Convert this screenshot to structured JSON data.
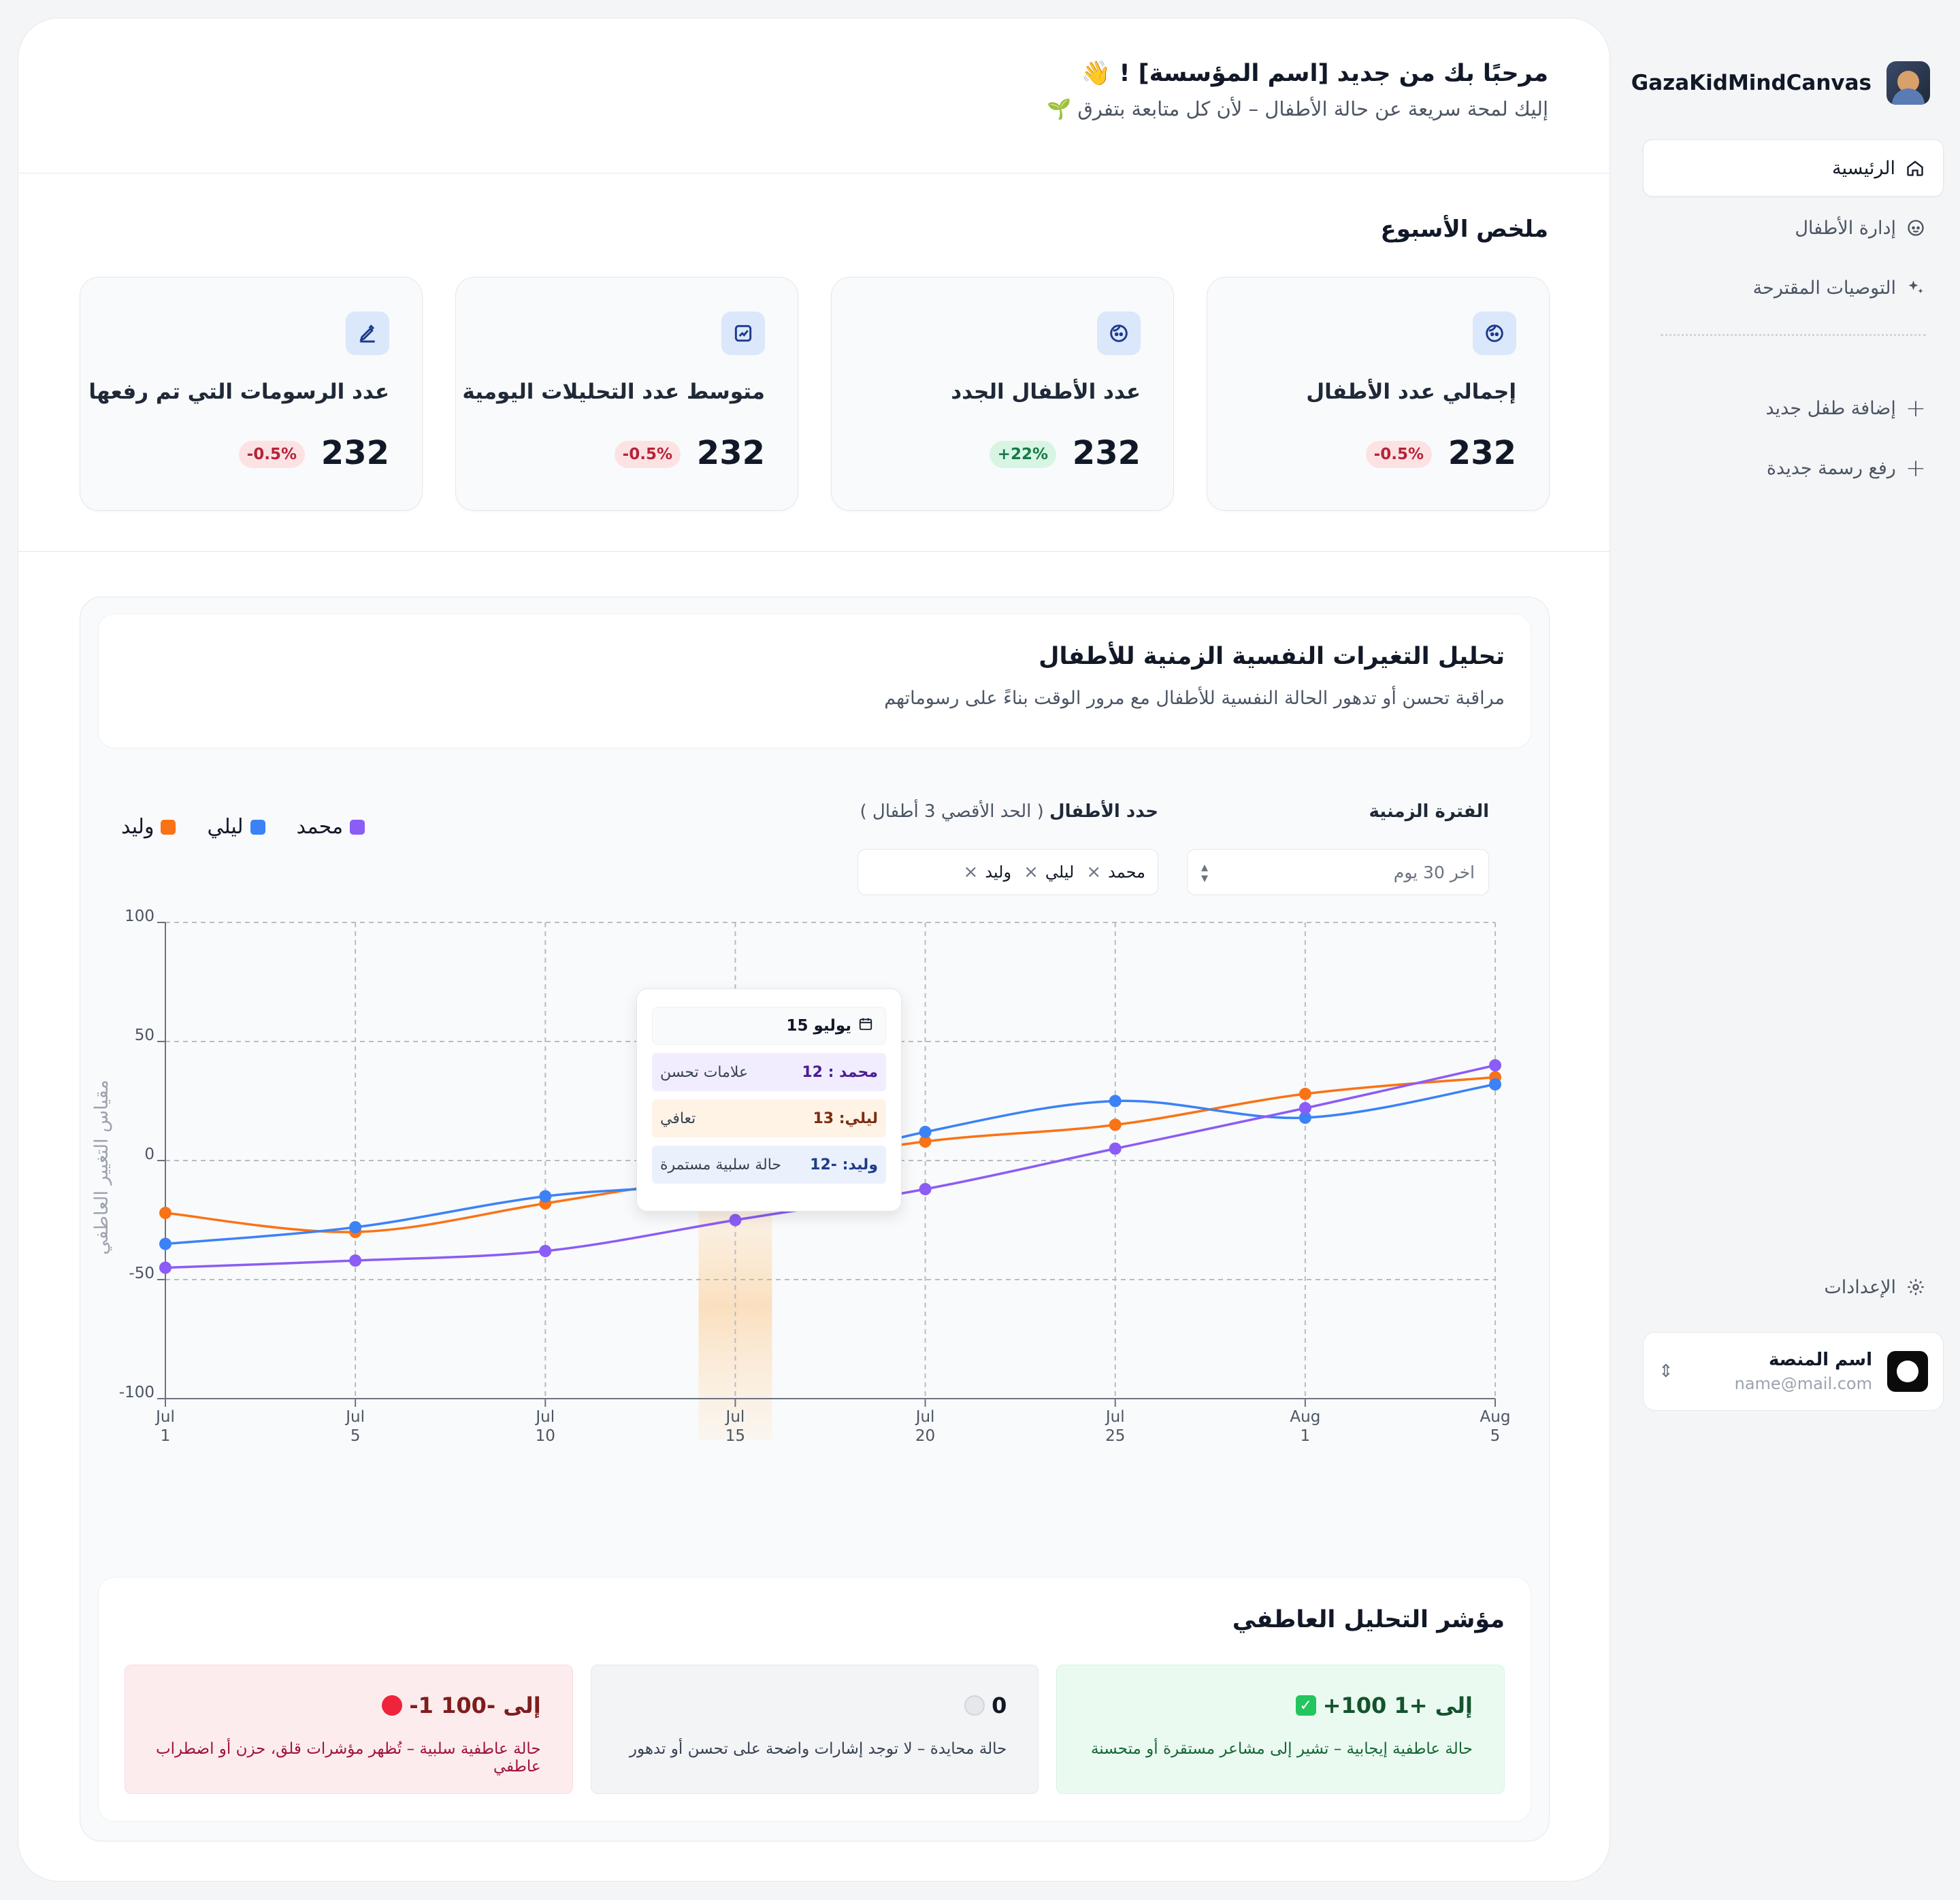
{
  "brand": {
    "name": "GazaKidMindCanvas"
  },
  "nav": {
    "home": "الرئيسية",
    "children": "إدارة الأطفال",
    "recommendations": "التوصيات المقترحة",
    "add_child": "إضافة طفل جديد",
    "upload_drawing": "رفع رسمة جديدة",
    "settings": "الإعدادات"
  },
  "user": {
    "name": "اسم المنصة",
    "email": "name@mail.com"
  },
  "header": {
    "welcome": "مرحبًا بك من جديد [اسم المؤسسة] ! 👋",
    "subtitle": "إليك لمحة سريعة عن حالة الأطفال – لأن كل متابعة بتفرق 🌱"
  },
  "summary": {
    "title": "ملخص الأسبوع",
    "cards": [
      {
        "label": "إجمالي عدد الأطفال",
        "value": "232",
        "change": "-0.5%"
      },
      {
        "label": "عدد الأطفال الجدد",
        "value": "232",
        "change": "+22%"
      },
      {
        "label": "متوسط عدد التحليلات اليومية",
        "value": "232",
        "change": "-0.5%"
      },
      {
        "label": "عدد الرسومات التي تم رفعها",
        "value": "232",
        "change": "-0.5%"
      }
    ]
  },
  "chart_section": {
    "title": "تحليل التغيرات النفسية الزمنية للأطفال",
    "subtitle": "مراقبة تحسن أو تدهور الحالة النفسية للأطفال مع مرور الوقت بناءً على رسوماتهم",
    "period_label": "الفترة الزمنية",
    "period_value": "اخر 30 يوم",
    "kids_label": "حدد الأطفال",
    "kids_hint": "( الحد الأقصي 3 أطفال )",
    "selected_kids": [
      "محمد",
      "ليلي",
      "وليد"
    ]
  },
  "tooltip": {
    "date": "15 يوليو",
    "rows": [
      {
        "name": "محمد : 12",
        "note": "علامات تحسن"
      },
      {
        "name": "ليلي: 13",
        "note": "تعافي"
      },
      {
        "name": "وليد: -12",
        "note": "حالة سلبية مستمرة"
      }
    ]
  },
  "chart_data": {
    "type": "line",
    "ylabel": "مقياس التغيير العاطفي",
    "ylim": [
      -100,
      100
    ],
    "yticks": [
      "-100",
      "-50",
      "0",
      "50",
      "100"
    ],
    "x": [
      "Jul 1",
      "Jul 5",
      "Jul 10",
      "Jul 15",
      "Jul 20",
      "Jul 25",
      "Aug 1",
      "Aug 5"
    ],
    "highlight_x": "Jul 15",
    "grid": true,
    "legend_position": "top-left",
    "series": [
      {
        "name": "محمد",
        "color": "#8b5cf6",
        "values": [
          -45,
          -42,
          -38,
          -25,
          -12,
          5,
          22,
          40
        ]
      },
      {
        "name": "ليلي",
        "color": "#3b82f6",
        "values": [
          -35,
          -28,
          -15,
          -8,
          12,
          25,
          18,
          32
        ]
      },
      {
        "name": "وليد",
        "color": "#f97316",
        "values": [
          -22,
          -30,
          -18,
          -5,
          8,
          15,
          28,
          35
        ]
      }
    ]
  },
  "indicator": {
    "title": "مؤشر التحليل العاطفي",
    "cards": [
      {
        "range": "+100 إلى +1",
        "desc": "حالة عاطفية إيجابية – تشير إلى مشاعر مستقرة أو متحسنة"
      },
      {
        "range": "0",
        "desc": "حالة محايدة – لا توجد إشارات واضحة على تحسن أو تدهور"
      },
      {
        "range": "-1 إلى -100",
        "desc": "حالة عاطفية سلبية – تُظهر مؤشرات قلق، حزن أو اضطراب عاطفي"
      }
    ]
  }
}
